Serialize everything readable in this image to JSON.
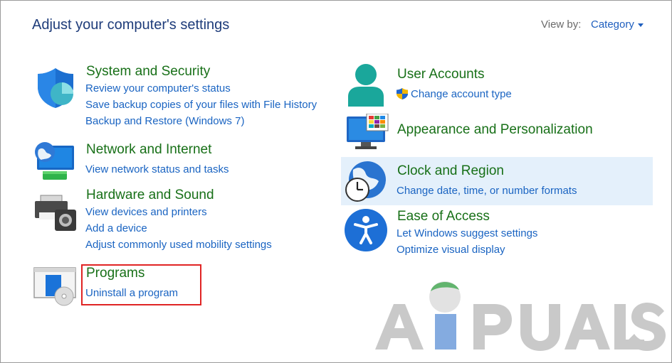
{
  "header": {
    "title": "Adjust your computer's settings",
    "view_by_label": "View by:",
    "view_by_value": "Category"
  },
  "categories": {
    "system": {
      "title": "System and Security",
      "icon": "shield-icon",
      "links": [
        "Review your computer's status",
        "Save backup copies of your files with File History",
        "Backup and Restore (Windows 7)"
      ]
    },
    "network": {
      "title": "Network and Internet",
      "icon": "network-globe-icon",
      "links": [
        "View network status and tasks"
      ]
    },
    "hardware": {
      "title": "Hardware and Sound",
      "icon": "printer-speaker-icon",
      "links": [
        "View devices and printers",
        "Add a device",
        "Adjust commonly used mobility settings"
      ]
    },
    "programs": {
      "title": "Programs",
      "icon": "programs-disc-icon",
      "links": [
        "Uninstall a program"
      ]
    },
    "user": {
      "title": "User Accounts",
      "icon": "user-icon",
      "links": [
        "Change account type"
      ]
    },
    "appearance": {
      "title": "Appearance and Personalization",
      "icon": "monitor-color-icon",
      "links": []
    },
    "clock": {
      "title": "Clock and Region",
      "icon": "clock-globe-icon",
      "links": [
        "Change date, time, or number formats"
      ]
    },
    "ease": {
      "title": "Ease of Access",
      "icon": "accessibility-icon",
      "links": [
        "Let Windows suggest settings",
        "Optimize visual display"
      ]
    }
  },
  "watermark": {
    "text": "APPUALS"
  },
  "colors": {
    "category_title": "#187018",
    "link": "#1a64c2",
    "title": "#1e3c7a",
    "highlight": "#e4f0fb",
    "annotation": "#e02424"
  }
}
